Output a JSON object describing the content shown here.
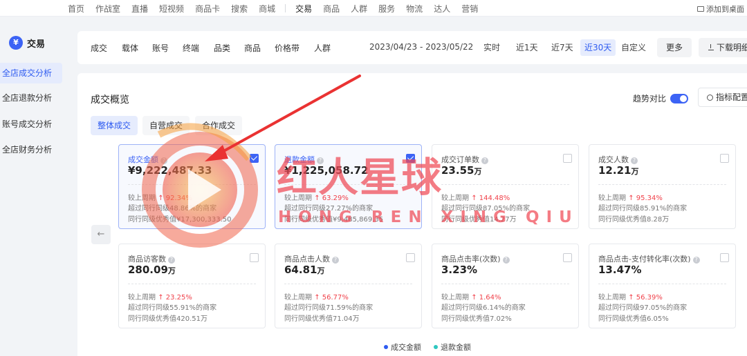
{
  "topnav": {
    "items": [
      "首页",
      "作战室",
      "直播",
      "短视频",
      "商品卡",
      "搜索",
      "商城",
      "交易",
      "商品",
      "人群",
      "服务",
      "物流",
      "达人",
      "营销"
    ],
    "active_index": 7,
    "add_desktop": "添加到桌面"
  },
  "sidebar": {
    "header": "交易",
    "items": [
      "全店成交分析",
      "全店退款分析",
      "账号成交分析",
      "全店财务分析"
    ],
    "active_index": 0
  },
  "filterbar": {
    "tabs": [
      "成交",
      "载体",
      "账号",
      "终端",
      "品类",
      "商品",
      "价格带",
      "人群"
    ],
    "date_range": "2023/04/23 - 2023/05/22",
    "time_buttons": [
      "实时",
      "近1天",
      "近7天",
      "近30天",
      "自定义"
    ],
    "active_time": 3,
    "more": "更多",
    "download": "下载明细"
  },
  "overview": {
    "title": "成交概览",
    "trend_label": "趋势对比",
    "trend_on": true,
    "config": "指标配置",
    "subtabs": [
      "整体成交",
      "自营成交",
      "合作成交"
    ],
    "active_subtab": 0,
    "back_arrow": "←",
    "cards": [
      {
        "title": "成交金额",
        "value": "¥9,222,487.33",
        "unit": "",
        "change_label": "较上周期",
        "change": "92.34%",
        "rank": "超过同行同级48.86%的商家",
        "best": "同行同级优秀值¥17,300,333.50",
        "checked": true
      },
      {
        "title": "退款金额",
        "value": "¥1,225,058.72",
        "unit": "",
        "change_label": "较上周期",
        "change": "63.29%",
        "rank": "超过同行同级27.27%的商家",
        "best": "同行同级优秀值¥9,485,869.35",
        "checked": true
      },
      {
        "title": "成交订单数",
        "value": "23.55",
        "unit": "万",
        "change_label": "较上周期",
        "change": "144.48%",
        "rank": "超过同行同级87.05%的商家",
        "best": "同行同级优秀值14.27万",
        "checked": false
      },
      {
        "title": "成交人数",
        "value": "12.21",
        "unit": "万",
        "change_label": "较上周期",
        "change": "95.34%",
        "rank": "超过同行同级85.91%的商家",
        "best": "同行同级优秀值8.28万",
        "checked": false
      },
      {
        "title": "商品访客数",
        "value": "280.09",
        "unit": "万",
        "change_label": "较上周期",
        "change": "23.25%",
        "rank": "超过同行同级55.91%的商家",
        "best": "同行同级优秀值420.51万",
        "checked": false
      },
      {
        "title": "商品点击人数",
        "value": "64.81",
        "unit": "万",
        "change_label": "较上周期",
        "change": "56.77%",
        "rank": "超过同行同级71.59%的商家",
        "best": "同行同级优秀值71.04万",
        "checked": false
      },
      {
        "title": "商品点击率(次数)",
        "value": "3.23%",
        "unit": "",
        "change_label": "较上周期",
        "change": "1.64%",
        "rank": "超过同行同级6.14%的商家",
        "best": "同行同级优秀值7.02%",
        "checked": false
      },
      {
        "title": "商品点击-支付转化率(次数)",
        "value": "13.47%",
        "unit": "",
        "change_label": "较上周期",
        "change": "56.39%",
        "rank": "超过同行同级97.05%的商家",
        "best": "同行同级优秀值6.05%",
        "checked": false
      }
    ],
    "legend": [
      {
        "label": "成交金额",
        "color": "#2e5bf0"
      },
      {
        "label": "退款金额",
        "color": "#2ec7c0"
      }
    ]
  },
  "watermark": {
    "text": "红人星球",
    "sub": "HONG REN XING QIU"
  },
  "colors": {
    "accent": "#3c63f5",
    "up": "#f0414a",
    "annotation": "#ea3232"
  }
}
